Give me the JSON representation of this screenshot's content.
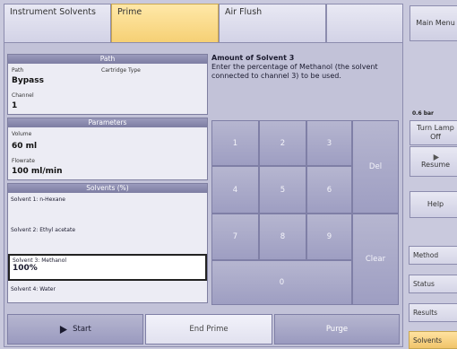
{
  "tabs": [
    {
      "label": "Instrument Solvents",
      "active": false
    },
    {
      "label": "Prime",
      "active": true
    },
    {
      "label": "Air Flush",
      "active": false
    }
  ],
  "path_panel": {
    "title": "Path",
    "path_label": "Path",
    "cartridge_label": "Cartridge Type",
    "path_value": "Bypass",
    "channel_label": "Channel",
    "channel_value": "1"
  },
  "params_panel": {
    "title": "Parameters",
    "volume_label": "Volume",
    "volume_value": "60 ml",
    "flowrate_label": "Flowrate",
    "flowrate_value": "100 ml/min"
  },
  "solvents_panel": {
    "title": "Solvents (%)",
    "items": [
      {
        "label": "Solvent 1: n-Hexane",
        "value": ""
      },
      {
        "label": "Solvent 2: Ethyl acetate",
        "value": ""
      },
      {
        "label": "Solvent 3: Methanol",
        "value": "100%"
      },
      {
        "label": "Solvent 4: Water",
        "value": ""
      }
    ]
  },
  "instruction": {
    "title": "Amount of Solvent 3",
    "text": "Enter the percentage of Methanol (the solvent connected to channel 3) to be used."
  },
  "keypad": {
    "k1": "1",
    "k2": "2",
    "k3": "3",
    "k4": "4",
    "k5": "5",
    "k6": "6",
    "k7": "7",
    "k8": "8",
    "k9": "9",
    "k0": "0",
    "del": "Del",
    "clear": "Clear"
  },
  "bottom": {
    "start": "Start",
    "end_prime": "End Prime",
    "purge": "Purge"
  },
  "right": {
    "main_menu": "Main Menu",
    "pressure": "0.6 bar",
    "turn_lamp_off": "Turn Lamp Off",
    "resume": "Resume",
    "help": "Help",
    "method": "Method",
    "status": "Status",
    "results": "Results",
    "solvents": "Solvents"
  },
  "icons": {
    "start": "play-icon",
    "resume": "play-icon"
  }
}
